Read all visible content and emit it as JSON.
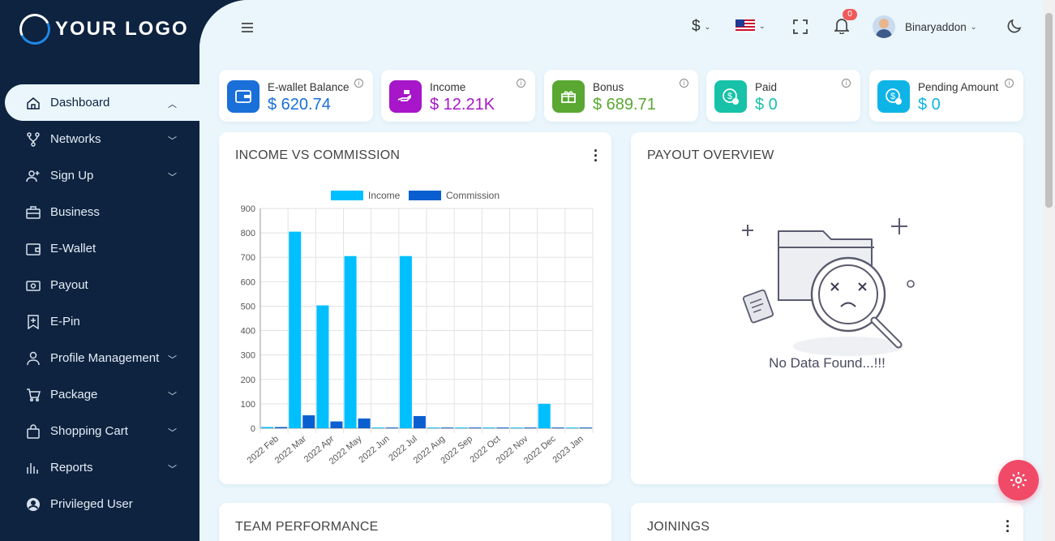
{
  "brand": {
    "logo_text": "YOUR LOGO"
  },
  "sidebar": {
    "items": [
      {
        "label": "Dashboard",
        "icon": "home-icon",
        "active": true,
        "chevron": "up"
      },
      {
        "label": "Networks",
        "icon": "network-icon",
        "chevron": "down"
      },
      {
        "label": "Sign Up",
        "icon": "user-plus-icon",
        "chevron": "down"
      },
      {
        "label": "Business",
        "icon": "briefcase-icon"
      },
      {
        "label": "E-Wallet",
        "icon": "wallet-icon"
      },
      {
        "label": "Payout",
        "icon": "cash-icon"
      },
      {
        "label": "E-Pin",
        "icon": "pin-bookmark-icon"
      },
      {
        "label": "Profile Management",
        "icon": "user-icon",
        "chevron": "down"
      },
      {
        "label": "Package",
        "icon": "cart-icon",
        "chevron": "down"
      },
      {
        "label": "Shopping Cart",
        "icon": "bag-icon",
        "chevron": "down"
      },
      {
        "label": "Reports",
        "icon": "bar-chart-icon",
        "chevron": "down"
      },
      {
        "label": "Privileged User",
        "icon": "user-circle-icon"
      }
    ]
  },
  "header": {
    "currency": "$",
    "notifications": "0",
    "username": "Binaryaddon"
  },
  "stats": [
    {
      "label": "E-wallet Balance",
      "value": "$ 620.74",
      "color": "#1a6fd8",
      "icon": "wallet-icon"
    },
    {
      "label": "Income",
      "value": "$ 12.21K",
      "color": "#a716c8",
      "icon": "income-hand-icon"
    },
    {
      "label": "Bonus",
      "value": "$ 689.71",
      "color": "#5aa832",
      "icon": "bonus-gift-icon"
    },
    {
      "label": "Paid",
      "value": "$ 0",
      "color": "#17c2a8",
      "icon": "paid-coin-icon"
    },
    {
      "label": "Pending Amount",
      "value": "$ 0",
      "color": "#0fb4e6",
      "icon": "pending-coin-icon"
    }
  ],
  "panels": {
    "income_commission": "INCOME VS COMMISSION",
    "payout_overview": "PAYOUT OVERVIEW",
    "no_data": "No Data Found...!!!",
    "team_performance": "TEAM PERFORMANCE",
    "joinings": "JOININGS"
  },
  "chart_data": {
    "type": "bar",
    "title": "",
    "categories": [
      "2022 Feb",
      "2022 Mar",
      "2022 Apr",
      "2022 May",
      "2022 Jun",
      "2022 Jul",
      "2022 Aug",
      "2022 Sep",
      "2022 Oct",
      "2022 Nov",
      "2022 Dec",
      "2023 Jan"
    ],
    "series": [
      {
        "name": "Income",
        "color": "#00bfff",
        "values": [
          5,
          805,
          503,
          705,
          3,
          705,
          3,
          3,
          3,
          3,
          100,
          3
        ]
      },
      {
        "name": "Commission",
        "color": "#0a5fd0",
        "values": [
          5,
          53,
          28,
          40,
          3,
          50,
          3,
          3,
          3,
          3,
          3,
          3
        ]
      }
    ],
    "ylim": [
      0,
      900
    ],
    "yticks": [
      0,
      100,
      200,
      300,
      400,
      500,
      600,
      700,
      800,
      900
    ],
    "grid": true,
    "legend": "top-center"
  }
}
